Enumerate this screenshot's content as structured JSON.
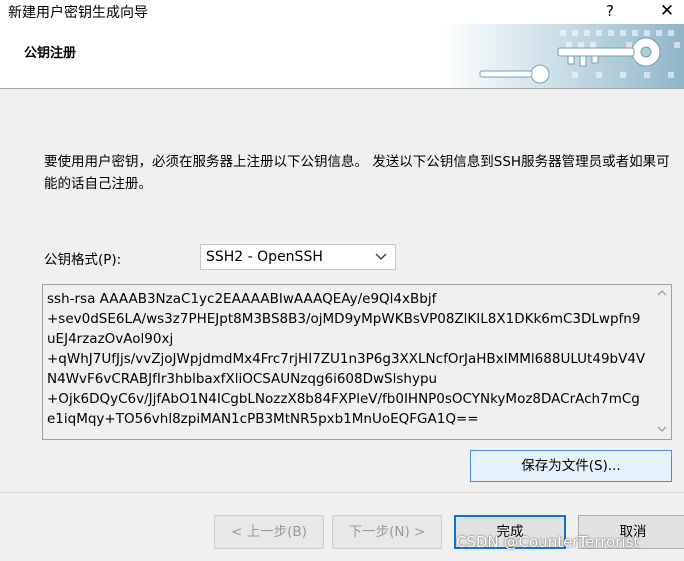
{
  "window": {
    "title": "新建用户密钥生成向导",
    "help_label": "?",
    "close_label": "✕"
  },
  "header": {
    "title": "公钥注册"
  },
  "main": {
    "description": "要使用用户密钥，必须在服务器上注册以下公钥信息。 发送以下公钥信息到SSH服务器管理员或者如果可能的话自己注册。",
    "format_label": "公钥格式(P):",
    "format_value": "SSH2 - OpenSSH",
    "public_key": "ssh-rsa AAAAB3NzaC1yc2EAAAABIwAAAQEAy/e9Ql4xBbjf\n+sev0dSE6LA/ws3z7PHEJpt8M3BS8B3/ojMD9yMpWKBsVP08ZlKIL8X1DKk6mC3DLwpfn9uEJ4rzazOvAol90xj\n+qWhJ7UfJjs/vvZjoJWpjdmdMx4Frc7rjHI7ZU1n3P6g3XXLNcfOrJaHBxIMMl688ULUt49bV4VN4WvF6vCRABJfIr3hblbaxfXliOCSAUNzqg6i608DwSlshypu\n+Ojk6DQyC6v/JjfAbO1N4ICgbLNozzX8b84FXPleV/fb0IHNP0sOCYNkyMoz8DACrAch7mCge1iqMqy+TO56vhl8zpiMAN1cPB3MtNR5pxb1MnUoEQFGA1Q==",
    "save_button": "保存为文件(S)..."
  },
  "footer": {
    "back_button": "< 上一步(B)",
    "next_button": "下一步(N) >",
    "finish_button": "完成",
    "cancel_button": "取消"
  },
  "watermark": "CSDN @CounterTerrorist",
  "colors": {
    "accent": "#1070d0",
    "dialog_bg": "#f0f0f0",
    "header_art": "#aecbd8"
  }
}
